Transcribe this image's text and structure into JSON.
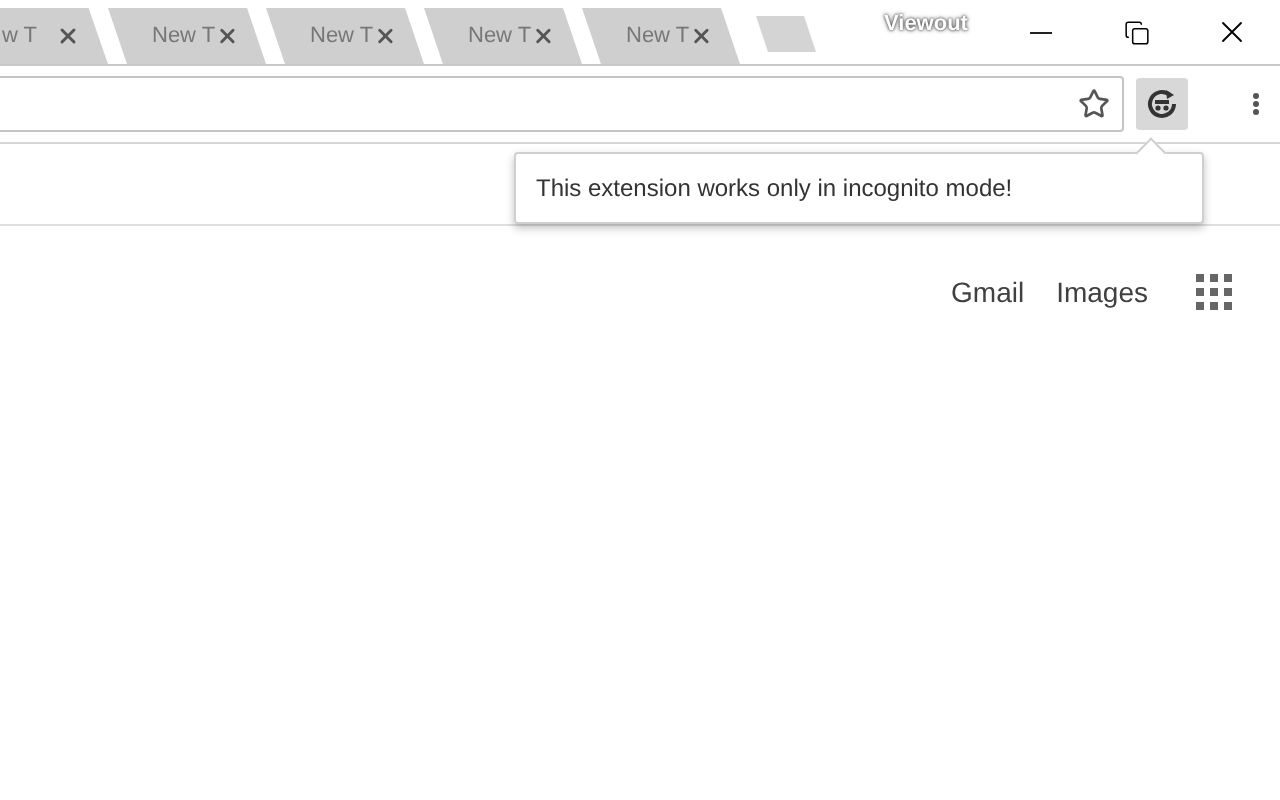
{
  "tabs": [
    {
      "label": "w T"
    },
    {
      "label": "New T"
    },
    {
      "label": "New T"
    },
    {
      "label": "New T"
    },
    {
      "label": "New T"
    }
  ],
  "window": {
    "title": "Viewout"
  },
  "popup": {
    "message": "This extension works only in incognito mode!"
  },
  "links": [
    "Gmail",
    "Images"
  ]
}
